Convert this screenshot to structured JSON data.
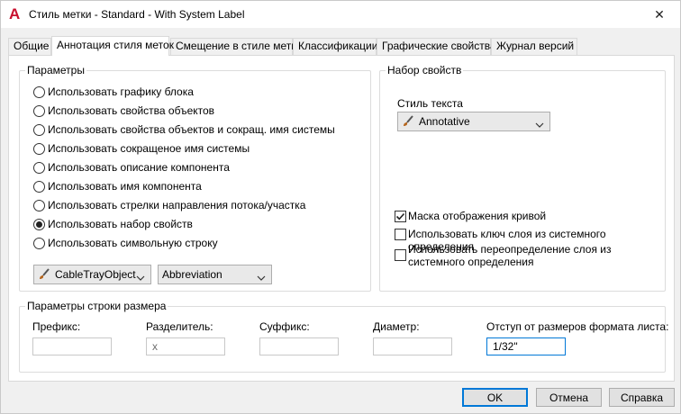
{
  "window": {
    "title": "Стиль метки - Standard - With System Label",
    "app_icon_letter": "A",
    "close_glyph": "✕"
  },
  "tabs": [
    {
      "label": "Общие",
      "active": false
    },
    {
      "label": "Аннотация стиля меток",
      "active": true
    },
    {
      "label": "Смещение в стиле метки",
      "active": false
    },
    {
      "label": "Классификации",
      "active": false
    },
    {
      "label": "Графические свойства",
      "active": false
    },
    {
      "label": "Журнал версий",
      "active": false
    }
  ],
  "params_group": {
    "title": "Параметры",
    "options": [
      {
        "label": "Использовать графику блока",
        "checked": false
      },
      {
        "label": "Использовать свойства объектов",
        "checked": false
      },
      {
        "label": "Использовать свойства объектов и сокращ. имя системы",
        "checked": false
      },
      {
        "label": "Использовать сокращеное имя системы",
        "checked": false
      },
      {
        "label": "Использовать описание компонента",
        "checked": false
      },
      {
        "label": "Использовать имя компонента",
        "checked": false
      },
      {
        "label": "Использовать стрелки направления потока/участка",
        "checked": false
      },
      {
        "label": "Использовать набор свойств",
        "checked": true
      },
      {
        "label": "Использовать символьную строку",
        "checked": false
      }
    ],
    "combo_object": "CableTrayObject",
    "combo_property": "Abbreviation"
  },
  "propset_group": {
    "title": "Набор свойств",
    "text_style_label": "Стиль текста",
    "text_style_value": "Annotative",
    "checks": [
      {
        "label": "Маска отображения кривой",
        "checked": true
      },
      {
        "label": "Использовать ключ слоя из системного определения",
        "checked": false
      },
      {
        "label": "Использовать переопределение слоя из системного определения",
        "checked": false
      }
    ]
  },
  "size_group": {
    "title": "Параметры строки размера",
    "fields": [
      {
        "label": "Префикс:",
        "value": ""
      },
      {
        "label": "Разделитель:",
        "value": "x"
      },
      {
        "label": "Суффикс:",
        "value": ""
      },
      {
        "label": "Диаметр:",
        "value": ""
      },
      {
        "label": "Отступ от размеров формата листа:",
        "value": "1/32\""
      }
    ]
  },
  "buttons": {
    "ok": "OK",
    "cancel": "Отмена",
    "help": "Справка"
  }
}
